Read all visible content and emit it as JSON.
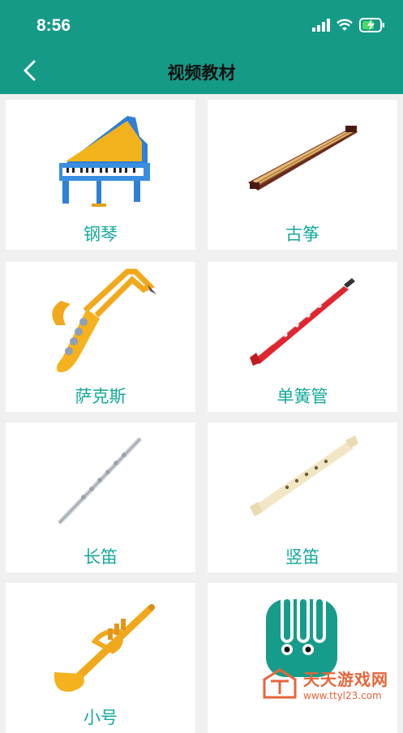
{
  "status_bar": {
    "time": "8:56"
  },
  "nav": {
    "title": "视频教材"
  },
  "instruments": [
    {
      "label": "钢琴",
      "icon": "piano-icon"
    },
    {
      "label": "古筝",
      "icon": "guzheng-icon"
    },
    {
      "label": "萨克斯",
      "icon": "saxophone-icon"
    },
    {
      "label": "单簧管",
      "icon": "clarinet-icon"
    },
    {
      "label": "长笛",
      "icon": "flute-icon"
    },
    {
      "label": "竖笛",
      "icon": "recorder-icon"
    },
    {
      "label": "小号",
      "icon": "trumpet-icon"
    },
    {
      "label": "",
      "icon": "music-app-icon"
    }
  ],
  "watermark": {
    "main": "天天游戏网",
    "sub": "www.ttyl23.com"
  },
  "colors": {
    "header": "#159a87",
    "label": "#15a89a",
    "background": "#f0f0f0"
  }
}
